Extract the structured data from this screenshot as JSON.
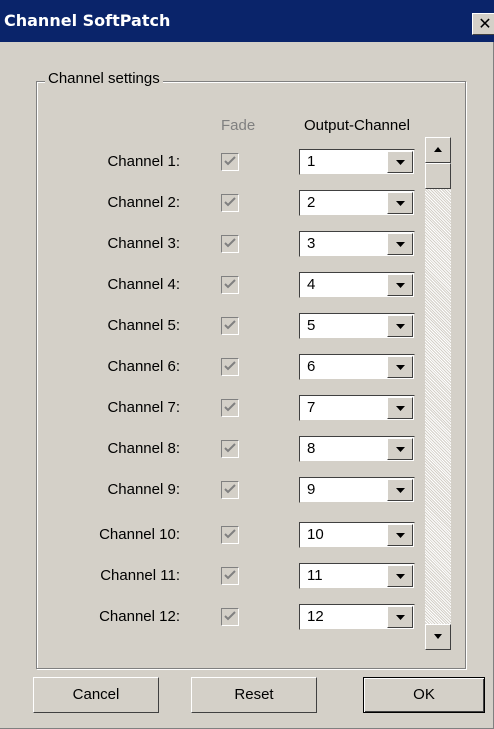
{
  "window": {
    "title": "Channel SoftPatch",
    "close_glyph": "✕"
  },
  "group": {
    "legend": "Channel settings"
  },
  "headers": {
    "fade": "Fade",
    "output": "Output-Channel"
  },
  "rows": [
    {
      "label": "Channel 1:",
      "fade_checked": true,
      "output": "1"
    },
    {
      "label": "Channel 2:",
      "fade_checked": true,
      "output": "2"
    },
    {
      "label": "Channel 3:",
      "fade_checked": true,
      "output": "3"
    },
    {
      "label": "Channel 4:",
      "fade_checked": true,
      "output": "4"
    },
    {
      "label": "Channel 5:",
      "fade_checked": true,
      "output": "5"
    },
    {
      "label": "Channel 6:",
      "fade_checked": true,
      "output": "6"
    },
    {
      "label": "Channel 7:",
      "fade_checked": true,
      "output": "7"
    },
    {
      "label": "Channel 8:",
      "fade_checked": true,
      "output": "8"
    },
    {
      "label": "Channel 9:",
      "fade_checked": true,
      "output": "9"
    },
    {
      "label": "Channel 10:",
      "fade_checked": true,
      "output": "10"
    },
    {
      "label": "Channel 11:",
      "fade_checked": true,
      "output": "11"
    },
    {
      "label": "Channel 12:",
      "fade_checked": true,
      "output": "12"
    }
  ],
  "buttons": {
    "cancel": "Cancel",
    "reset": "Reset",
    "ok": "OK"
  },
  "colors": {
    "titlebar": "#0a246a",
    "face": "#d4d0c8",
    "disabled_text": "#808080"
  }
}
